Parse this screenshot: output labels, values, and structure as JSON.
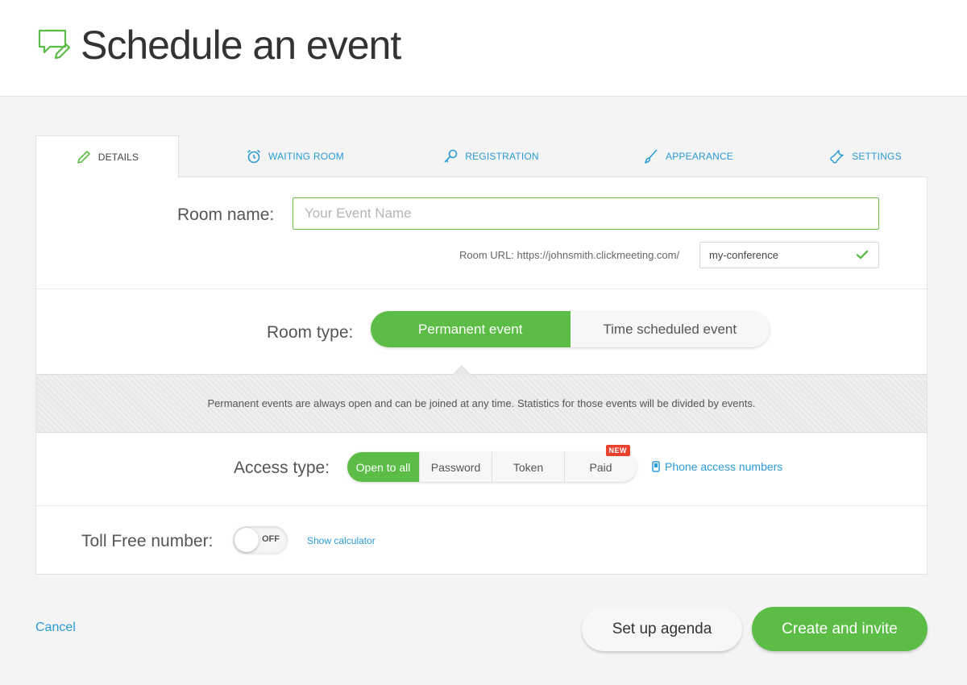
{
  "header": {
    "title": "Schedule an event",
    "icon": "chat-edit-icon"
  },
  "tabs": [
    {
      "label": "DETAILS",
      "icon": "pencil-icon",
      "active": true
    },
    {
      "label": "WAITING ROOM",
      "icon": "alarm-clock-icon",
      "active": false
    },
    {
      "label": "REGISTRATION",
      "icon": "key-icon",
      "active": false
    },
    {
      "label": "APPEARANCE",
      "icon": "brush-icon",
      "active": false
    },
    {
      "label": "SETTINGS",
      "icon": "wrench-icon",
      "active": false
    }
  ],
  "room": {
    "label": "Room name:",
    "placeholder": "Your Event Name",
    "value": "",
    "url_label": "Room URL: https://johnsmith.clickmeeting.com/",
    "url_slug": "my-conference"
  },
  "room_type": {
    "label": "Room type:",
    "options": [
      "Permanent event",
      "Time scheduled event"
    ],
    "selected": "Permanent event",
    "info": "Permanent events are always open and can be joined at any time. Statistics for those events will be divided by events."
  },
  "access": {
    "label": "Access type:",
    "options": [
      "Open to all",
      "Password",
      "Token",
      "Paid"
    ],
    "selected": "Open to all",
    "new_badge": "NEW",
    "phone_link": "Phone access numbers"
  },
  "toll_free": {
    "label": "Toll Free number:",
    "toggle_state": "OFF",
    "calculator_link": "Show calculator"
  },
  "footer": {
    "cancel": "Cancel",
    "agenda": "Set up agenda",
    "create": "Create and invite"
  },
  "colors": {
    "accent_green": "#5bbd45",
    "link_blue": "#2a9bd6",
    "badge_red": "#e8412d"
  }
}
